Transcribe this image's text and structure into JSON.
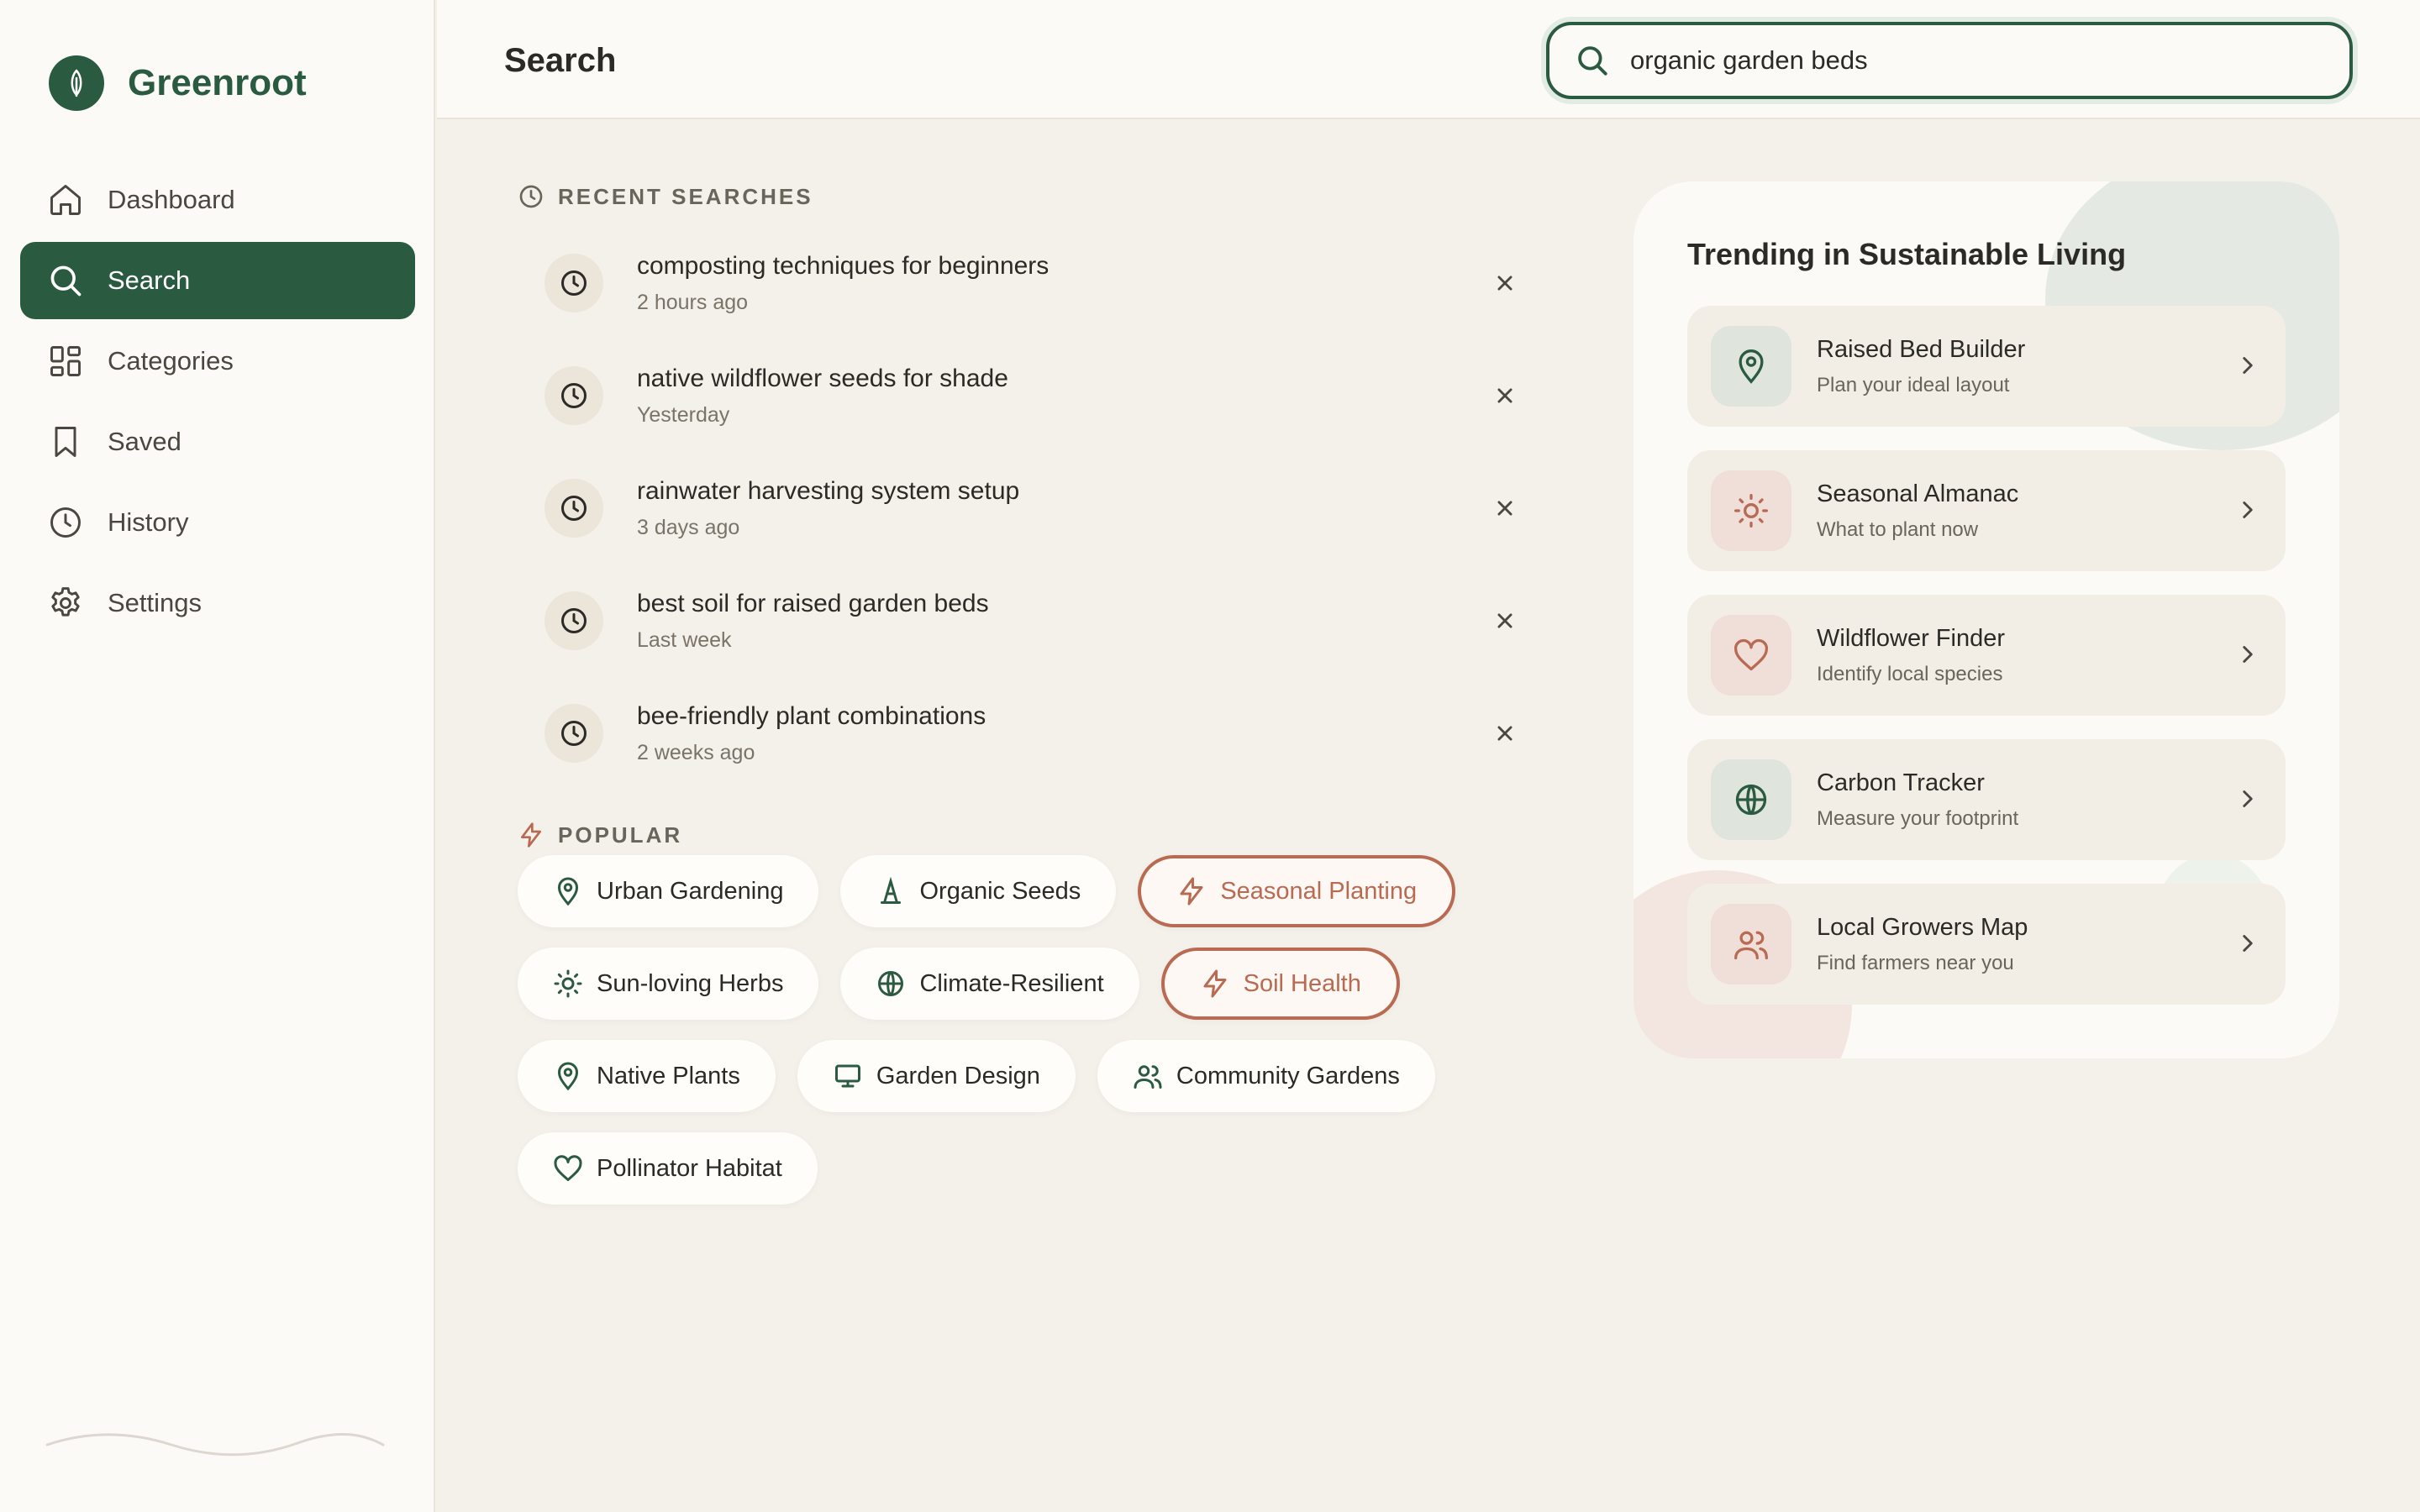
{
  "app": {
    "name": "Greenroot"
  },
  "sidebar": {
    "items": [
      {
        "label": "Dashboard",
        "icon": "home-icon"
      },
      {
        "label": "Search",
        "icon": "search-icon",
        "active": true
      },
      {
        "label": "Categories",
        "icon": "grid-icon"
      },
      {
        "label": "Saved",
        "icon": "bookmark-icon"
      },
      {
        "label": "History",
        "icon": "clock-icon"
      },
      {
        "label": "Settings",
        "icon": "gear-icon"
      }
    ]
  },
  "header": {
    "title": "Search",
    "search_value": "organic garden beds"
  },
  "recent": {
    "heading": "RECENT SEARCHES",
    "items": [
      {
        "query": "composting techniques for beginners",
        "time": "2 hours ago"
      },
      {
        "query": "native wildflower seeds for shade",
        "time": "Yesterday"
      },
      {
        "query": "rainwater harvesting system setup",
        "time": "3 days ago"
      },
      {
        "query": "best soil for raised garden beds",
        "time": "Last week"
      },
      {
        "query": "bee-friendly plant combinations",
        "time": "2 weeks ago"
      }
    ]
  },
  "popular": {
    "heading": "POPULAR",
    "chips": [
      {
        "label": "Urban Gardening",
        "icon": "map-pin-icon"
      },
      {
        "label": "Organic Seeds",
        "icon": "sprout-icon"
      },
      {
        "label": "Seasonal Planting",
        "icon": "bolt-icon",
        "highlight": true
      },
      {
        "label": "Sun-loving Herbs",
        "icon": "sun-icon"
      },
      {
        "label": "Climate-Resilient",
        "icon": "globe-icon"
      },
      {
        "label": "Soil Health",
        "icon": "bolt-icon",
        "highlight": true
      },
      {
        "label": "Native Plants",
        "icon": "map-pin-icon"
      },
      {
        "label": "Garden Design",
        "icon": "monitor-icon"
      },
      {
        "label": "Community Gardens",
        "icon": "users-icon"
      },
      {
        "label": "Pollinator Habitat",
        "icon": "heart-icon"
      }
    ]
  },
  "trending": {
    "title": "Trending in Sustainable Living",
    "items": [
      {
        "name": "Raised Bed Builder",
        "desc": "Plan your ideal layout",
        "icon": "map-pin-icon"
      },
      {
        "name": "Seasonal Almanac",
        "desc": "What to plant now",
        "icon": "sun-icon"
      },
      {
        "name": "Wildflower Finder",
        "desc": "Identify local species",
        "icon": "heart-icon"
      },
      {
        "name": "Carbon Tracker",
        "desc": "Measure your footprint",
        "icon": "globe-icon"
      },
      {
        "name": "Local Growers Map",
        "desc": "Find farmers near you",
        "icon": "users-icon"
      }
    ]
  },
  "colors": {
    "brand": "#2a5a40",
    "accent": "#b86a52",
    "background": "#f4f0ea",
    "surface": "#fbfaf6"
  }
}
